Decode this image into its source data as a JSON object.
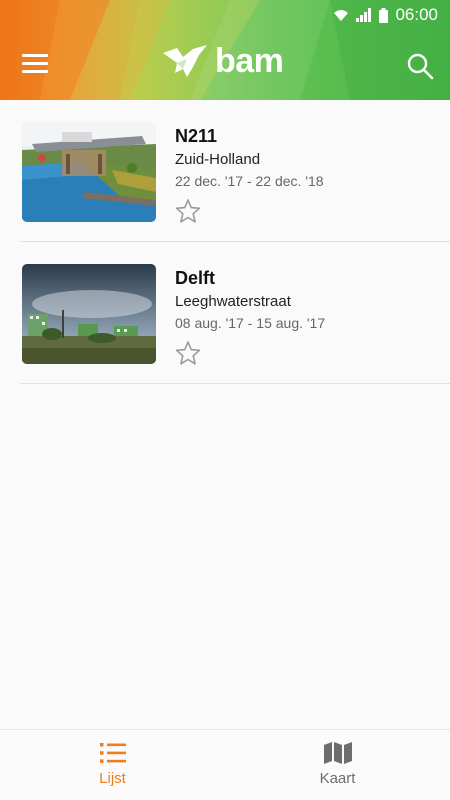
{
  "status_bar": {
    "time": "06:00"
  },
  "header": {
    "logo_text": "bam",
    "accent_color": "#f07c1b"
  },
  "projects": [
    {
      "title": "N211",
      "location": "Zuid-Holland",
      "dates": "22 dec. '17 - 22 dec. '18",
      "favorite": false
    },
    {
      "title": "Delft",
      "location": "Leeghwaterstraat",
      "dates": "08 aug. '17 - 15 aug. '17",
      "favorite": false
    }
  ],
  "bottom_nav": {
    "tabs": [
      {
        "label": "Lijst",
        "icon": "list-icon",
        "active": true
      },
      {
        "label": "Kaart",
        "icon": "map-icon",
        "active": false
      }
    ]
  }
}
